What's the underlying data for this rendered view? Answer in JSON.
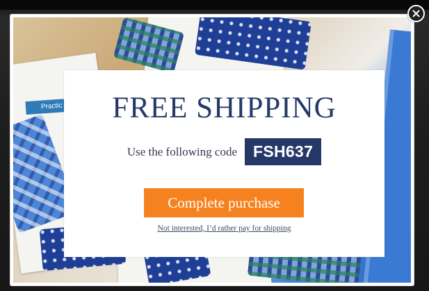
{
  "promo": {
    "title": "FREE SHIPPING",
    "code_label": "Use the following code",
    "code": "FSH637",
    "cta_label": "Complete purchase",
    "decline_label": "Not interested, I’d rather pay for shipping"
  },
  "background": {
    "tag_label": "Practic"
  },
  "colors": {
    "navy": "#253868",
    "orange": "#f6821f",
    "white": "#ffffff"
  },
  "icons": {
    "close": "close-icon"
  }
}
